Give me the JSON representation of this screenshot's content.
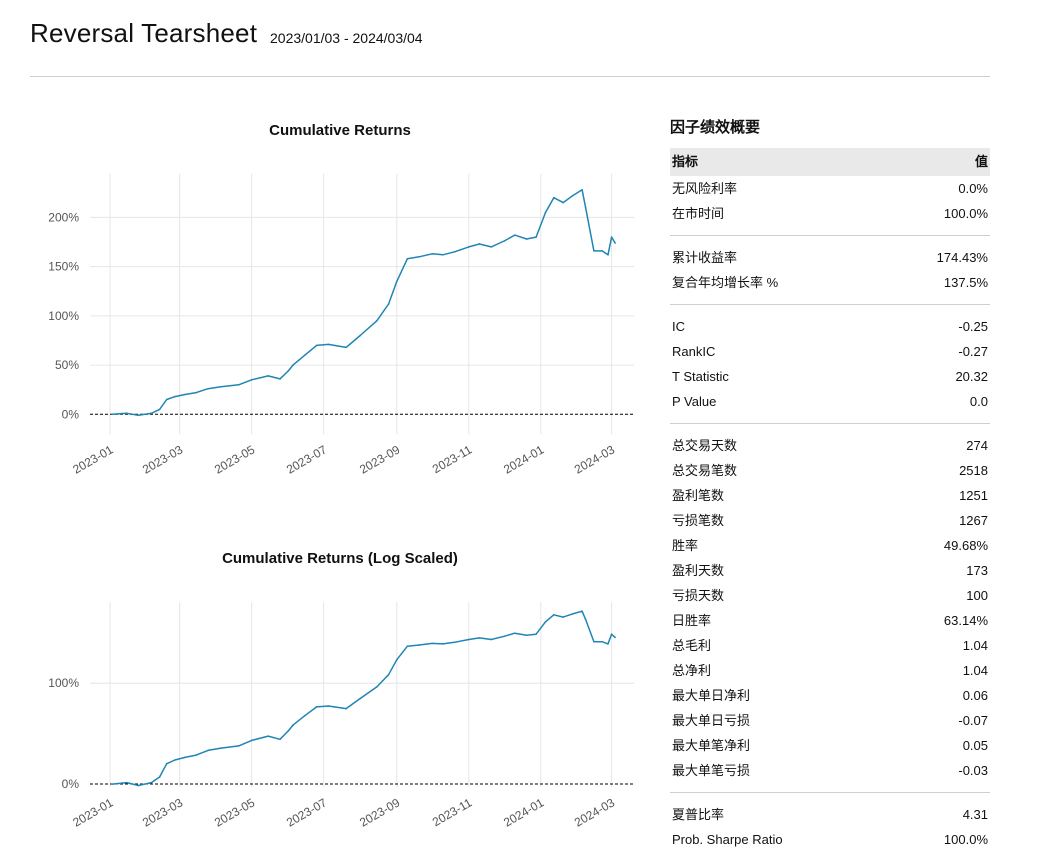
{
  "header": {
    "title": "Reversal Tearsheet",
    "date_range": "2023/01/03 - 2024/03/04"
  },
  "metrics": {
    "title": "因子绩效概要",
    "col_metric": "指标",
    "col_value": "值",
    "groups": [
      [
        {
          "label": "无风险利率",
          "value": "0.0%"
        },
        {
          "label": "在市时间",
          "value": "100.0%"
        }
      ],
      [
        {
          "label": "累计收益率",
          "value": "174.43%"
        },
        {
          "label": "复合年均增长率 %",
          "value": "137.5%"
        }
      ],
      [
        {
          "label": "IC",
          "value": "-0.25"
        },
        {
          "label": "RankIC",
          "value": "-0.27"
        },
        {
          "label": "T Statistic",
          "value": "20.32"
        },
        {
          "label": "P Value",
          "value": "0.0"
        }
      ],
      [
        {
          "label": "总交易天数",
          "value": "274"
        },
        {
          "label": "总交易笔数",
          "value": "2518"
        },
        {
          "label": "盈利笔数",
          "value": "1251"
        },
        {
          "label": "亏损笔数",
          "value": "1267"
        },
        {
          "label": "胜率",
          "value": "49.68%"
        },
        {
          "label": "盈利天数",
          "value": "173"
        },
        {
          "label": "亏损天数",
          "value": "100"
        },
        {
          "label": "日胜率",
          "value": "63.14%"
        },
        {
          "label": "总毛利",
          "value": "1.04"
        },
        {
          "label": "总净利",
          "value": "1.04"
        },
        {
          "label": "最大单日净利",
          "value": "0.06"
        },
        {
          "label": "最大单日亏损",
          "value": "-0.07"
        },
        {
          "label": "最大单笔净利",
          "value": "0.05"
        },
        {
          "label": "最大单笔亏损",
          "value": "-0.03"
        }
      ],
      [
        {
          "label": "夏普比率",
          "value": "4.31"
        },
        {
          "label": "Prob. Sharpe Ratio",
          "value": "100.0%"
        }
      ]
    ]
  },
  "chart_data": [
    {
      "type": "line",
      "title": "Cumulative Returns",
      "xlabel": "",
      "ylabel": "",
      "x_ticks": [
        "2023-01",
        "2023-03",
        "2023-05",
        "2023-07",
        "2023-09",
        "2023-11",
        "2024-01",
        "2024-03"
      ],
      "y_ticks": [
        "0%",
        "50%",
        "100%",
        "150%",
        "200%"
      ],
      "y_tick_values": [
        0,
        50,
        100,
        150,
        200
      ],
      "ylim": [
        -20,
        240
      ],
      "xlim": [
        "2022-12-15",
        "2024-03-20"
      ],
      "x": [
        "2023-01-03",
        "2023-01-15",
        "2023-01-25",
        "2023-02-05",
        "2023-02-12",
        "2023-02-18",
        "2023-02-25",
        "2023-03-05",
        "2023-03-15",
        "2023-03-25",
        "2023-04-05",
        "2023-04-20",
        "2023-05-01",
        "2023-05-15",
        "2023-05-25",
        "2023-06-01",
        "2023-06-05",
        "2023-06-15",
        "2023-06-25",
        "2023-07-05",
        "2023-07-10",
        "2023-07-20",
        "2023-08-01",
        "2023-08-15",
        "2023-08-25",
        "2023-09-01",
        "2023-09-10",
        "2023-09-20",
        "2023-10-01",
        "2023-10-10",
        "2023-10-20",
        "2023-11-01",
        "2023-11-10",
        "2023-11-20",
        "2023-12-01",
        "2023-12-10",
        "2023-12-20",
        "2023-12-28",
        "2024-01-05",
        "2024-01-12",
        "2024-01-20",
        "2024-01-28",
        "2024-02-05",
        "2024-02-08",
        "2024-02-15",
        "2024-02-22",
        "2024-02-27",
        "2024-03-01",
        "2024-03-04"
      ],
      "series": [
        {
          "values": [
            0,
            1,
            -1,
            1,
            5,
            15,
            18,
            20,
            22,
            26,
            28,
            30,
            35,
            39,
            36,
            44,
            50,
            60,
            70,
            71,
            70,
            68,
            80,
            95,
            112,
            135,
            158,
            160,
            163,
            162,
            165,
            170,
            173,
            170,
            176,
            182,
            178,
            180,
            205,
            220,
            215,
            222,
            228,
            210,
            166,
            166,
            162,
            180,
            174
          ]
        }
      ]
    },
    {
      "type": "line",
      "title": "Cumulative Returns (Log Scaled)",
      "xlabel": "",
      "ylabel": "",
      "x_ticks": [
        "2023-01",
        "2023-03",
        "2023-05",
        "2023-07",
        "2023-09",
        "2023-11",
        "2024-01",
        "2024-03"
      ],
      "y_ticks": [
        "0%",
        "100%"
      ],
      "y_tick_values": [
        0,
        100
      ],
      "y_scale": "log",
      "xlim": [
        "2022-12-15",
        "2024-03-20"
      ],
      "x": [
        "2023-01-03",
        "2023-01-15",
        "2023-01-25",
        "2023-02-05",
        "2023-02-12",
        "2023-02-18",
        "2023-02-25",
        "2023-03-05",
        "2023-03-15",
        "2023-03-25",
        "2023-04-05",
        "2023-04-20",
        "2023-05-01",
        "2023-05-15",
        "2023-05-25",
        "2023-06-01",
        "2023-06-05",
        "2023-06-15",
        "2023-06-25",
        "2023-07-05",
        "2023-07-10",
        "2023-07-20",
        "2023-08-01",
        "2023-08-15",
        "2023-08-25",
        "2023-09-01",
        "2023-09-10",
        "2023-09-20",
        "2023-10-01",
        "2023-10-10",
        "2023-10-20",
        "2023-11-01",
        "2023-11-10",
        "2023-11-20",
        "2023-12-01",
        "2023-12-10",
        "2023-12-20",
        "2023-12-28",
        "2024-01-05",
        "2024-01-12",
        "2024-01-20",
        "2024-01-28",
        "2024-02-05",
        "2024-02-08",
        "2024-02-15",
        "2024-02-22",
        "2024-02-27",
        "2024-03-01",
        "2024-03-04"
      ],
      "series": [
        {
          "values": [
            0,
            1,
            -1,
            1,
            5,
            15,
            18,
            20,
            22,
            26,
            28,
            30,
            35,
            39,
            36,
            44,
            50,
            60,
            70,
            71,
            70,
            68,
            80,
            95,
            112,
            135,
            158,
            160,
            163,
            162,
            165,
            170,
            173,
            170,
            176,
            182,
            178,
            180,
            205,
            220,
            215,
            222,
            228,
            210,
            166,
            166,
            162,
            180,
            174
          ]
        }
      ]
    }
  ]
}
